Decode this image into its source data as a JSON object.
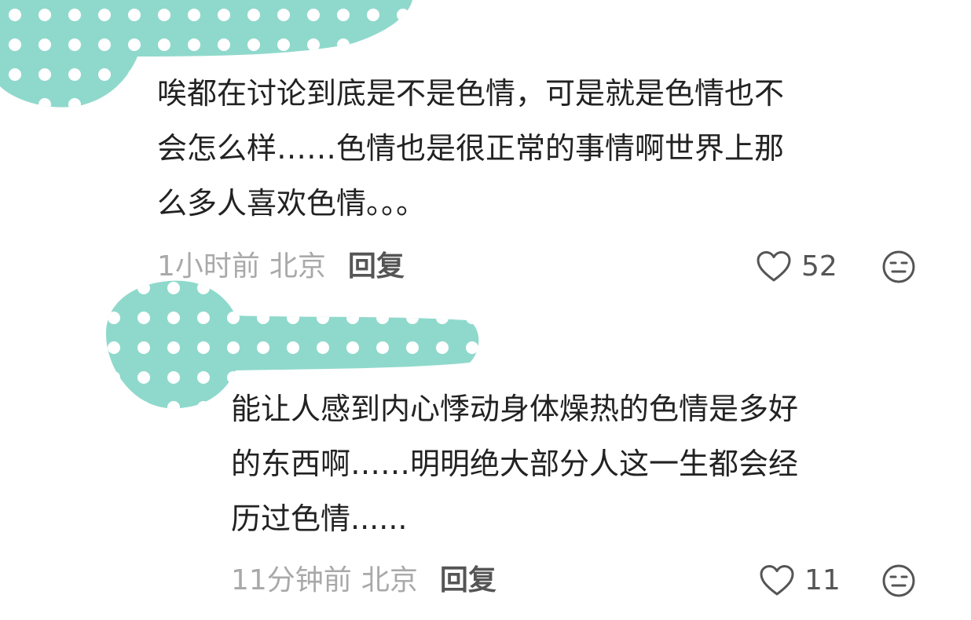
{
  "comments": [
    {
      "text_lines": [
        "唉都在讨论到底是不是色情，可是就是色情也不",
        "会怎么样……色情也是很正常的事情啊世界上那",
        "么多人喜欢色情。。。"
      ],
      "time": "1小时前",
      "location": "北京",
      "reply_label": "回复",
      "like_count": "52",
      "icons": {
        "like": "heart-outline-icon",
        "dislike": "neutral-face-icon"
      }
    },
    {
      "text_lines": [
        "能让人感到内心悸动身体燥热的色情是多好",
        "的东西啊……明明绝大部分人这一生都会经",
        "历过色情......"
      ],
      "time": "11分钟前",
      "location": "北京",
      "reply_label": "回复",
      "like_count": "11",
      "icons": {
        "like": "heart-outline-icon",
        "dislike": "neutral-face-icon"
      }
    }
  ],
  "redaction_color": "#8fd9cc"
}
